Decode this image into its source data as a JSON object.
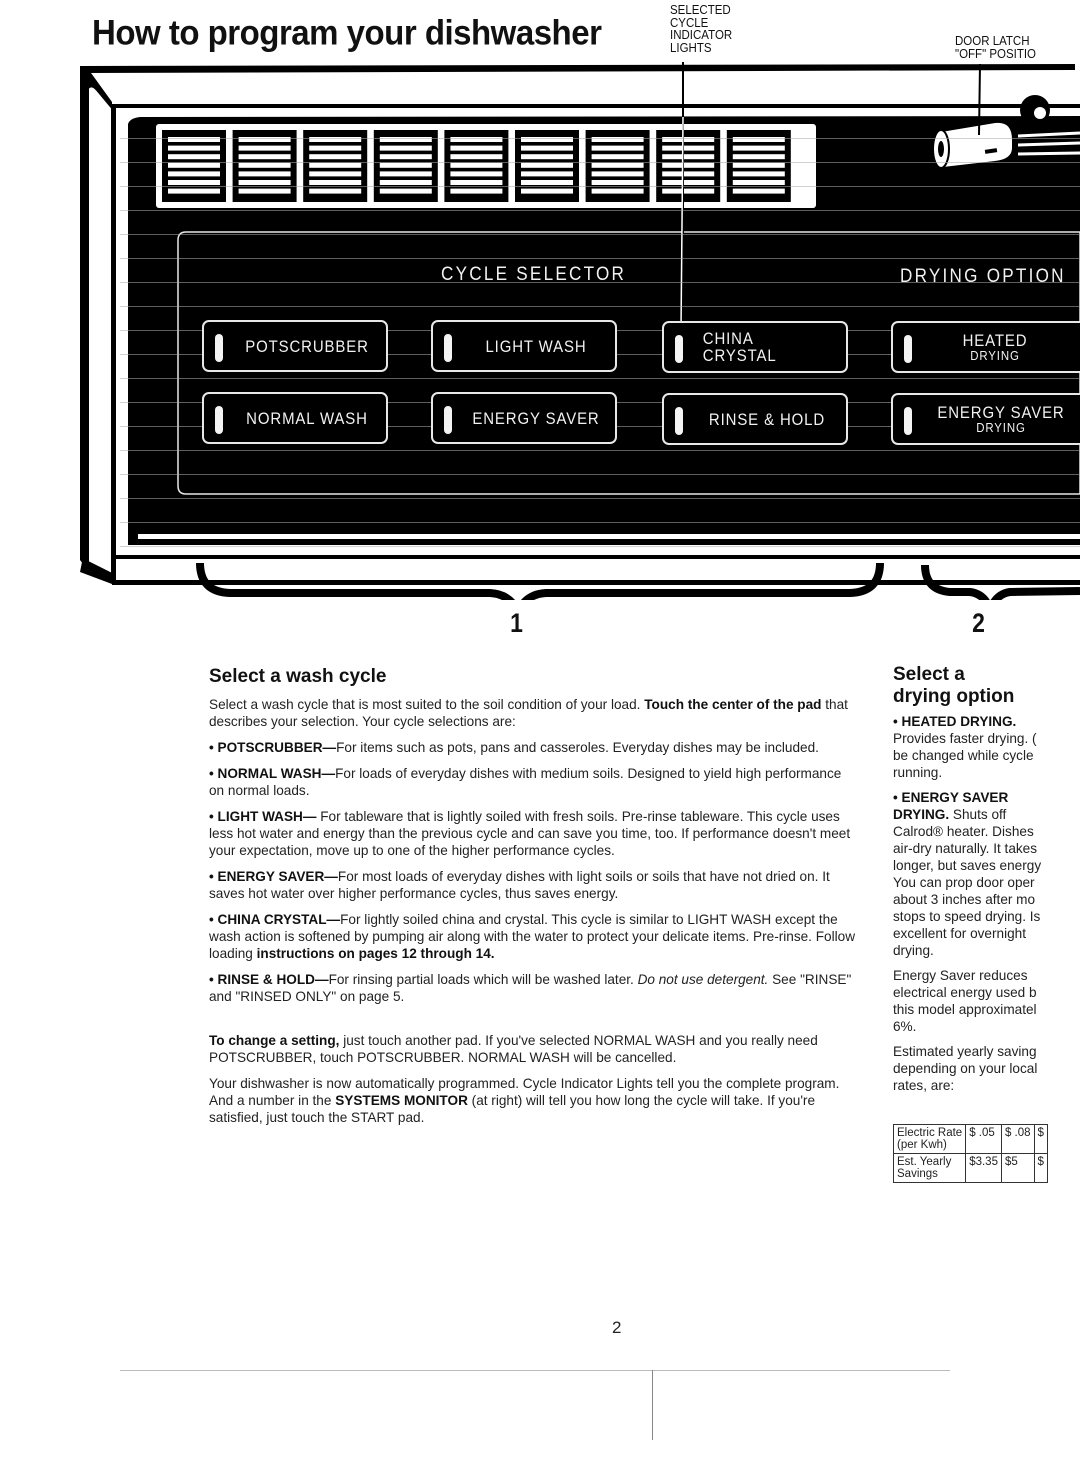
{
  "header": {
    "title": "How to program your dishwasher",
    "callouts": {
      "indicator_lights": [
        "SELECTED",
        "CYCLE",
        "INDICATOR",
        "LIGHTS"
      ],
      "door_latch": [
        "DOOR LATCH",
        "\"OFF\" POSITIO"
      ]
    }
  },
  "panel": {
    "cycle_selector_label": "CYCLE SELECTOR",
    "drying_options_label": "DRYING OPTION",
    "cycle_pads": [
      {
        "label": "POTSCRUBBER"
      },
      {
        "label": "LIGHT WASH"
      },
      {
        "label": "CHINA CRYSTAL"
      },
      {
        "label": "NORMAL WASH"
      },
      {
        "label": "ENERGY SAVER"
      },
      {
        "label": "RINSE & HOLD"
      }
    ],
    "drying_pads": [
      {
        "label": "HEATED",
        "sub": "DRYING"
      },
      {
        "label": "ENERGY SAVER",
        "sub": "DRYING"
      }
    ],
    "step_numbers": [
      "1",
      "2"
    ]
  },
  "wash_section": {
    "heading": "Select a wash cycle",
    "intro_plain": "Select a wash cycle that is most suited to the soil condition of your load. ",
    "intro_bold": "Touch the center of the pad",
    "intro_rest": " that describes your selection. Your cycle selections are:",
    "items": [
      {
        "name": "• POTSCRUBBER—",
        "text": "For items such as pots, pans and casseroles. Everyday dishes may be included."
      },
      {
        "name": "• NORMAL WASH—",
        "text": "For loads of everyday dishes with medium soils. Designed to yield high performance on normal loads."
      },
      {
        "name": "• LIGHT WASH— ",
        "text": "For tableware that is lightly soiled with fresh soils. Pre-rinse tableware. This cycle uses less hot water and energy than the previous cycle and can save you time, too. If performance doesn't meet your expectation, move up to one of the higher performance cycles."
      },
      {
        "name": "• ENERGY SAVER—",
        "text": "For most loads of everyday dishes with light soils or soils that have not dried on. It saves hot water over higher performance cycles, thus saves energy."
      },
      {
        "name": "• CHINA CRYSTAL—",
        "text": "For lightly soiled china and crystal. This cycle is similar to LIGHT WASH except the wash action is softened by pumping air along with the water to protect your delicate items. Pre-rinse. Follow loading ",
        "bold_tail": "instructions on pages 12 through 14."
      },
      {
        "name": "• RINSE & HOLD—",
        "text": "For rinsing partial loads which will be washed later. ",
        "italic": "Do not use detergent.",
        "tail": " See \"RINSE\" and \"RINSED ONLY\" on page 5."
      }
    ],
    "change_bold": "To change a setting,",
    "change_text": " just touch another pad. If you've selected NORMAL WASH and you really need POTSCRUBBER, touch POTSCRUBBER. NORMAL WASH will be cancelled.",
    "final_a": "Your dishwasher is now automatically programmed. Cycle Indicator Lights tell you the complete program. And a number in the ",
    "final_bold": "SYSTEMS MONITOR",
    "final_b": " (at right) will tell you how long the cycle will take. If you're satisfied, just touch the START pad."
  },
  "drying_section": {
    "heading_line1": "Select a",
    "heading_line2": "drying option",
    "heated_title": "• HEATED DRYING.",
    "heated_lines": [
      "Provides faster drying. (",
      "be changed while cycle",
      "running."
    ],
    "saver_title1": "• ENERGY SAVER",
    "saver_title2": "DRYING.",
    "saver_title2_rest": " Shuts off",
    "saver_lines": [
      "Calrod® heater. Dishes",
      "air-dry naturally. It takes",
      "longer, but saves energy",
      "You can prop door oper",
      "about 3 inches after mo",
      "stops to speed drying. Is",
      "excellent for overnight",
      "drying."
    ],
    "reduces_lines": [
      "Energy Saver reduces",
      "electrical energy used b",
      "this model approximatel",
      "6%."
    ],
    "estimate_lines": [
      "Estimated yearly saving",
      "depending on your local",
      "rates, are:"
    ],
    "table": {
      "rows": [
        {
          "label": [
            "Electric Rate",
            "(per Kwh)"
          ],
          "cells": [
            "$ .05",
            "$ .08",
            "$"
          ]
        },
        {
          "label": [
            "Est. Yearly",
            "Savings"
          ],
          "cells": [
            "$3.35",
            "$5",
            "$"
          ]
        }
      ]
    }
  },
  "footer": {
    "page_number": "2"
  }
}
